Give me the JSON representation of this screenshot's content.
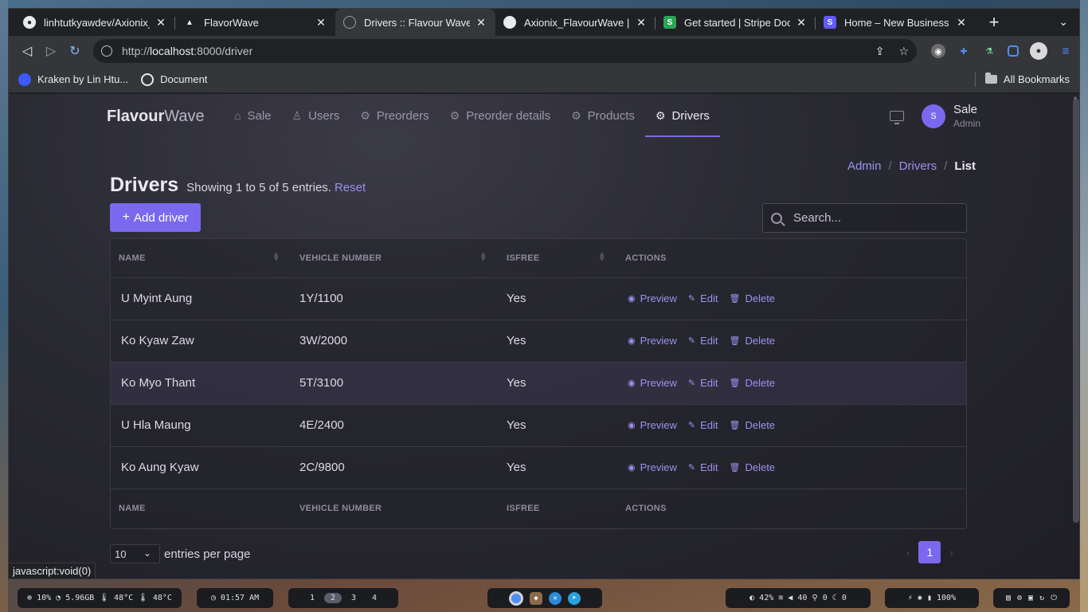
{
  "tabs": [
    {
      "title": "linhtutkyawdev/Axionix_",
      "icon": "github-icon",
      "active": false
    },
    {
      "title": "FlavorWave",
      "icon": "triangle-icon",
      "active": false
    },
    {
      "title": "Drivers :: Flavour Wave",
      "icon": "globe-icon",
      "active": true
    },
    {
      "title": "Axionix_FlavourWave |",
      "icon": "circle-icon",
      "active": false
    },
    {
      "title": "Get started | Stripe Doc",
      "icon": "stripe-icon",
      "active": false
    },
    {
      "title": "Home – New Business",
      "icon": "stripe-icon",
      "active": false
    }
  ],
  "address": {
    "scheme": "http://",
    "host": "localhost",
    "rest": ":8000/driver"
  },
  "bookmarks": {
    "items": [
      "Kraken by Lin Htu...",
      "Document"
    ],
    "all": "All Bookmarks"
  },
  "app": {
    "brand_a": "Flavour",
    "brand_b": "Wave",
    "menu": [
      "Sale",
      "Users",
      "Preorders",
      "Preorder details",
      "Products",
      "Drivers"
    ],
    "user": {
      "initial": "S",
      "name": "Sale",
      "role": "Admin"
    }
  },
  "breadcrumb": [
    "Admin",
    "Drivers",
    "List"
  ],
  "page": {
    "title": "Drivers",
    "showing": "Showing 1 to 5 of 5 entries.",
    "reset": "Reset",
    "add_button": "Add driver",
    "search_placeholder": "Search..."
  },
  "table": {
    "columns": [
      "NAME",
      "VEHICLE NUMBER",
      "ISFREE",
      "ACTIONS"
    ],
    "rows": [
      {
        "name": "U Myint Aung",
        "vehicle": "1Y/1100",
        "isfree": "Yes"
      },
      {
        "name": "Ko Kyaw Zaw",
        "vehicle": "3W/2000",
        "isfree": "Yes"
      },
      {
        "name": "Ko Myo Thant",
        "vehicle": "5T/3100",
        "isfree": "Yes"
      },
      {
        "name": "U Hla Maung",
        "vehicle": "4E/2400",
        "isfree": "Yes"
      },
      {
        "name": "Ko Aung Kyaw",
        "vehicle": "2C/9800",
        "isfree": "Yes"
      }
    ],
    "actions": [
      "Preview",
      "Edit",
      "Delete"
    ]
  },
  "pagination": {
    "per_page": "10",
    "label": "entries per page",
    "current": "1"
  },
  "status_tip": "javascript:void(0)",
  "taskbar": {
    "stats": "⊕ 10%  ◔ 5.96GB  🌡 48°C  🌡 48°C",
    "clock": "◷ 01:57 AM",
    "workspaces": [
      "1",
      "2",
      "3",
      "4"
    ],
    "system": "◐ 42%  ≋  ◀ 40  ⚲ 0  ☾ 0",
    "battery": "⚡ ✱ ▮ 100%"
  },
  "colors": {
    "accent": "#7b68ee",
    "link": "#9d91f0"
  }
}
